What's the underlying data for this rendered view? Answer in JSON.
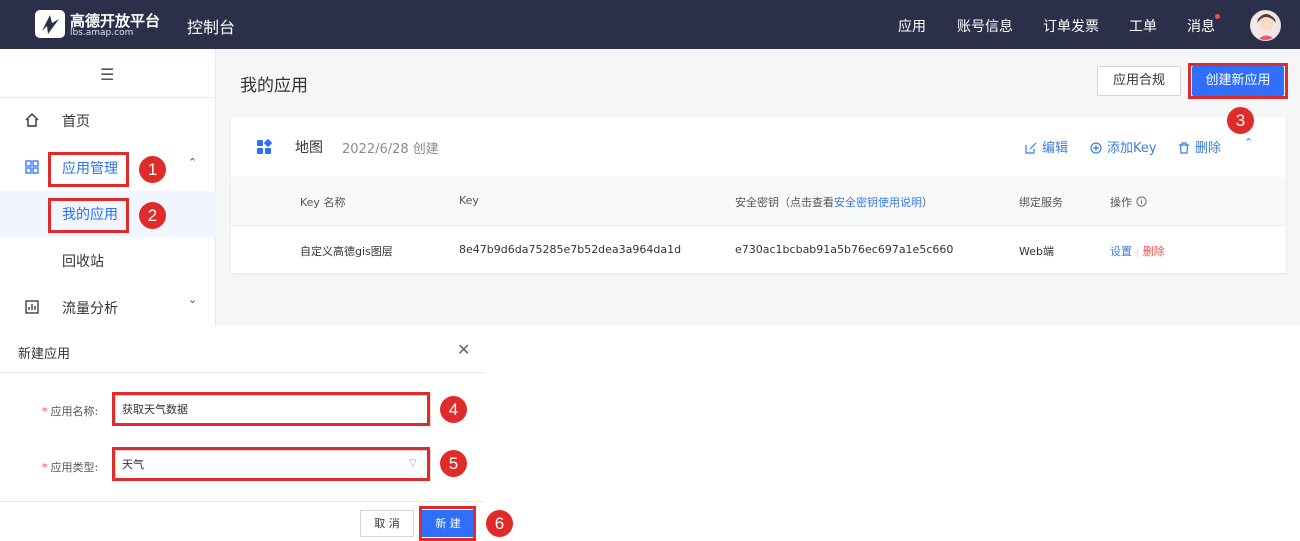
{
  "topbar": {
    "logo_cn": "高德开放平台",
    "logo_en": "lbs.amap.com",
    "console": "控制台",
    "nav": [
      "应用",
      "账号信息",
      "订单发票",
      "工单",
      "消息"
    ]
  },
  "sidebar": {
    "items": [
      {
        "label": "首页",
        "icon": "home-icon"
      },
      {
        "label": "应用管理",
        "icon": "grid-icon"
      },
      {
        "label": "我的应用"
      },
      {
        "label": "回收站"
      },
      {
        "label": "流量分析",
        "icon": "chart-icon"
      }
    ]
  },
  "main": {
    "title": "我的应用",
    "compliance_btn": "应用合规",
    "create_btn": "创建新应用",
    "card": {
      "name": "地图",
      "date": "2022/6/28 创建",
      "edit": "编辑",
      "add_key": "添加Key",
      "delete": "删除",
      "columns": [
        "Key 名称",
        "Key",
        "安全密钥（点击查看",
        "安全密钥使用说明",
        "）",
        "绑定服务",
        "操作"
      ],
      "row": {
        "name": "自定义高德gis图层",
        "key": "8e47b9d6da75285e7b52dea3a964da1d",
        "secret": "e730ac1bcbab91a5b76ec697a1e5c660",
        "service": "Web端",
        "settings": "设置",
        "remove": "删除"
      }
    }
  },
  "dialog": {
    "title": "新建应用",
    "name_label": "应用名称:",
    "name_value": "获取天气数据",
    "type_label": "应用类型:",
    "type_value": "天气",
    "cancel": "取 消",
    "submit": "新 建"
  },
  "annotations": [
    "1",
    "2",
    "3",
    "4",
    "5",
    "6"
  ],
  "colors": {
    "topbar": "#2b2f4a",
    "primary": "#2f6ffb",
    "highlight": "#e02b2b",
    "link": "#3a7be6"
  }
}
